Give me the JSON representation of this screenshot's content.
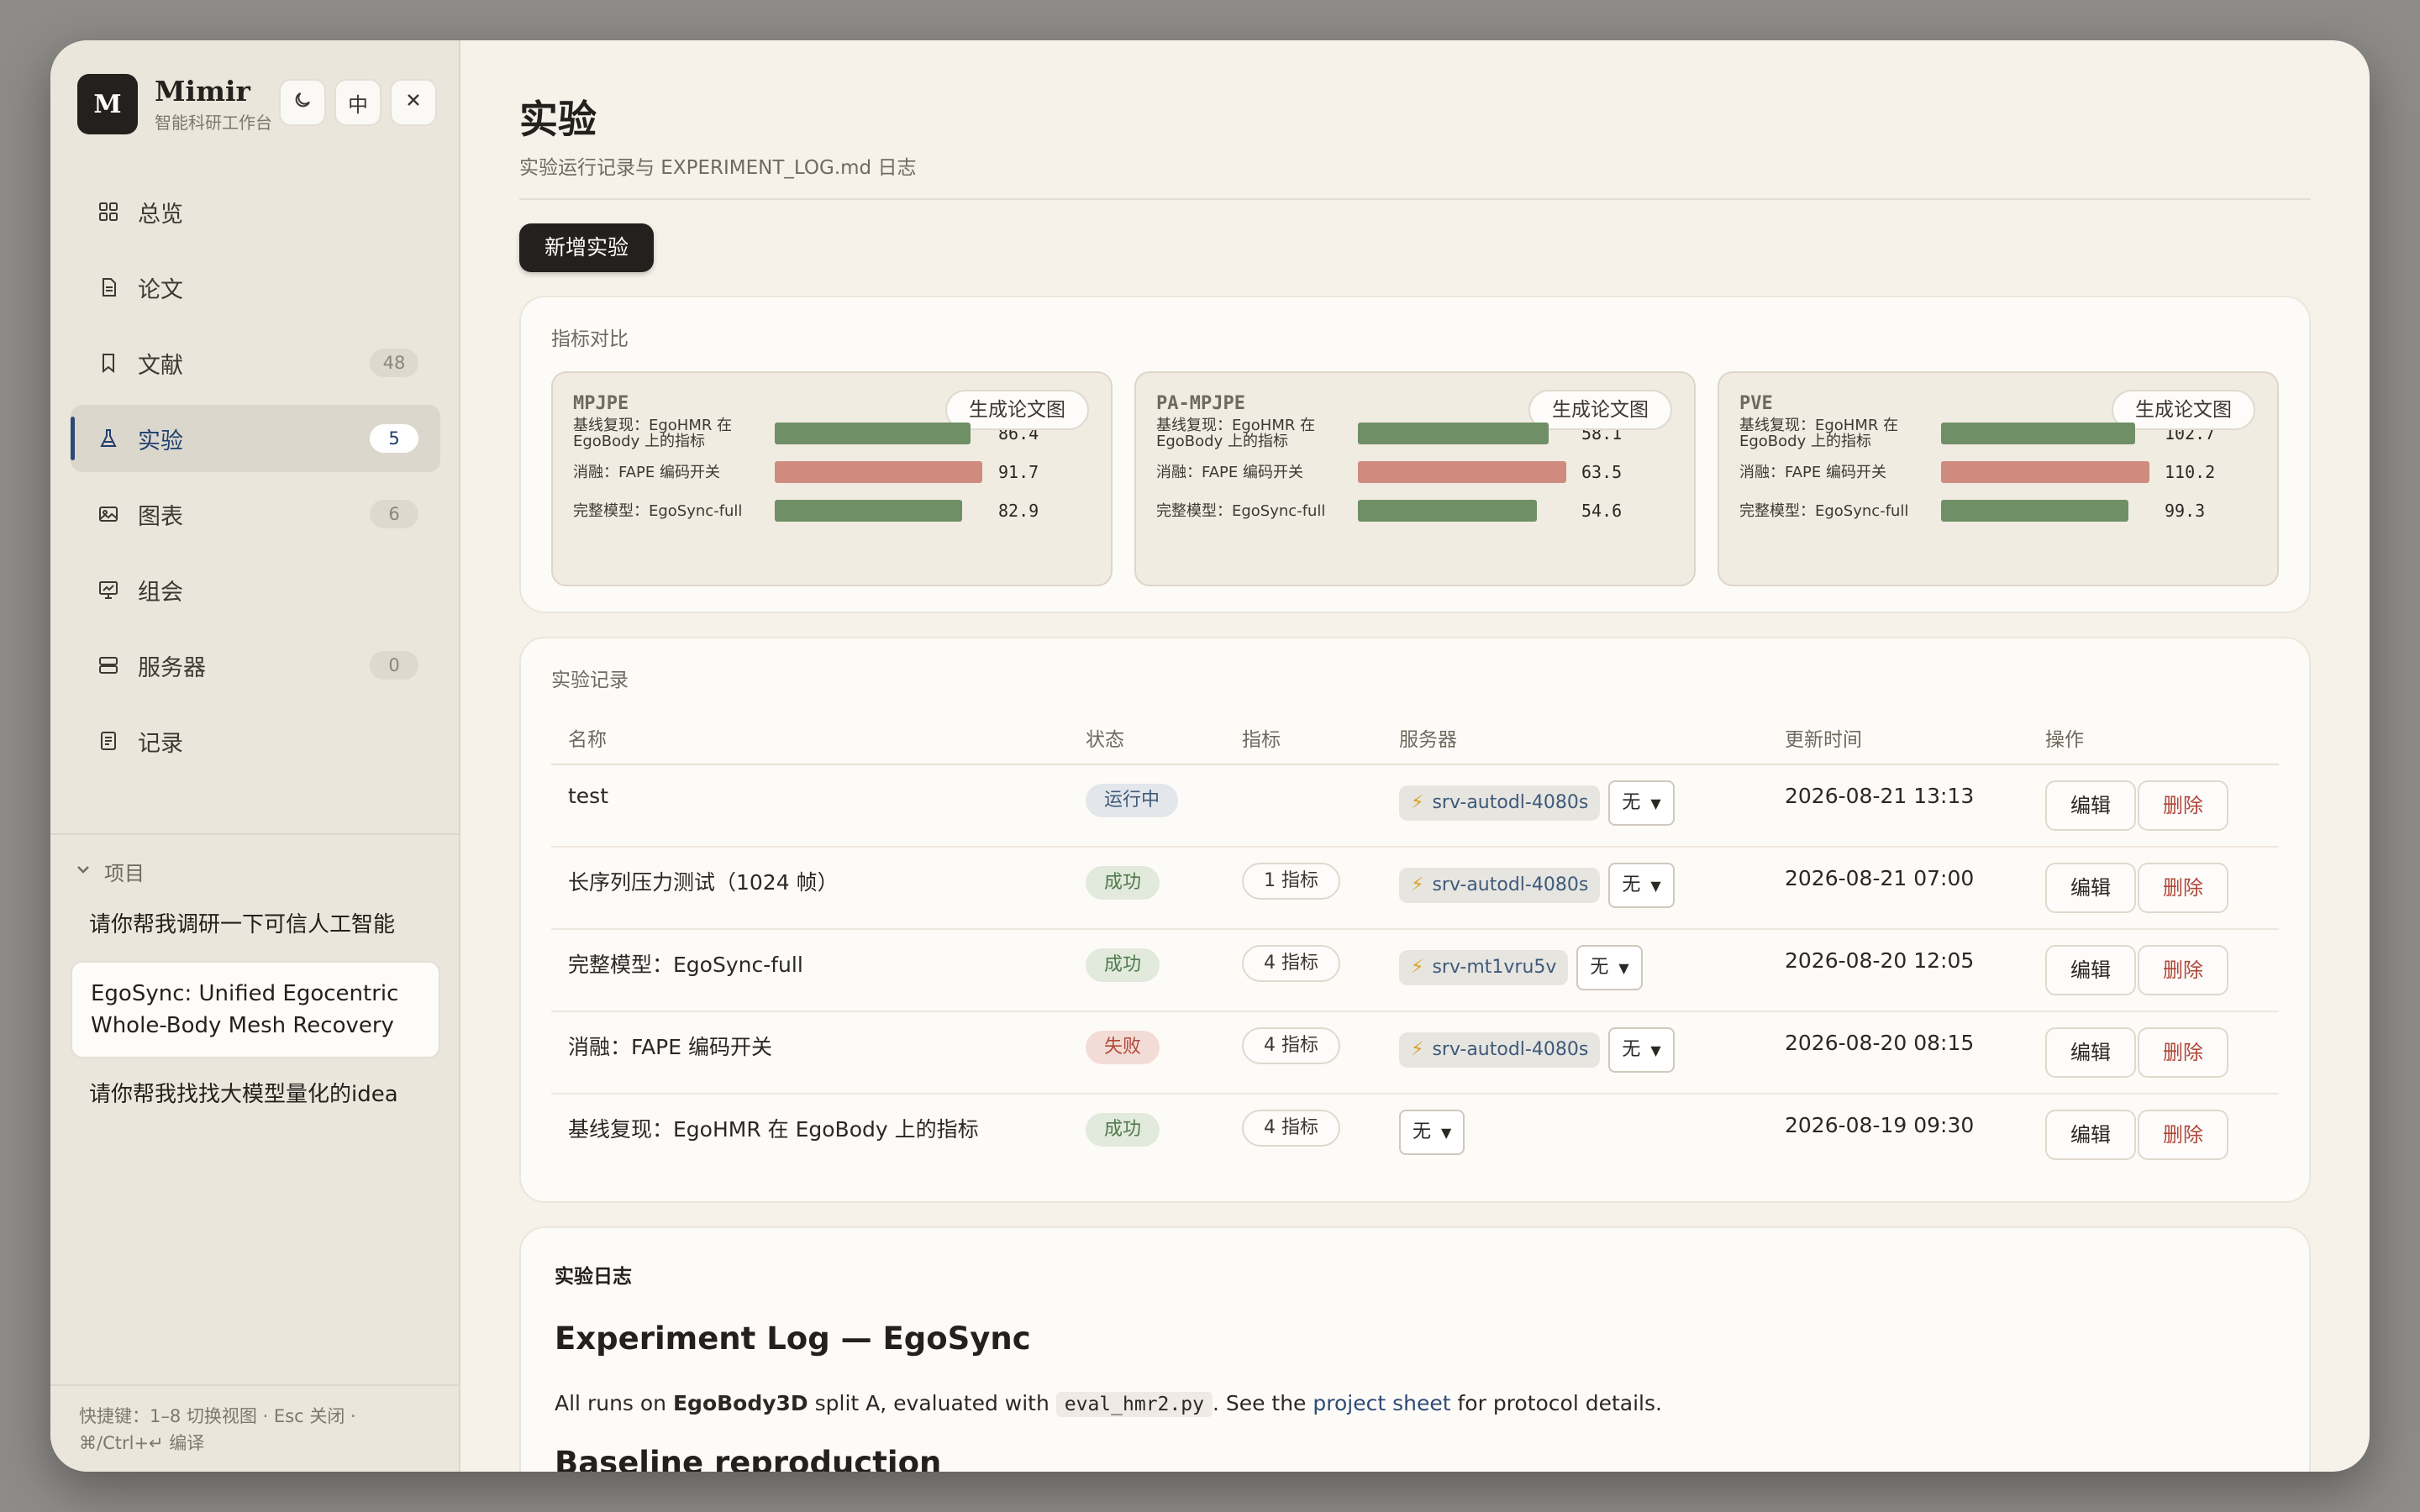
{
  "brand": {
    "name": "Mimir",
    "subtitle": "智能科研工作台",
    "logo_letter": "M"
  },
  "header_buttons": {
    "theme_icon": "moon-icon",
    "lang": "中",
    "close_icon": "close-icon"
  },
  "nav": [
    {
      "label": "总览",
      "icon": "grid-icon",
      "count": ""
    },
    {
      "label": "论文",
      "icon": "document-icon",
      "count": ""
    },
    {
      "label": "文献",
      "icon": "bookmark-icon",
      "count": "48"
    },
    {
      "label": "实验",
      "icon": "flask-icon",
      "count": "5"
    },
    {
      "label": "图表",
      "icon": "image-icon",
      "count": "6"
    },
    {
      "label": "组会",
      "icon": "presentation-icon",
      "count": ""
    },
    {
      "label": "服务器",
      "icon": "server-icon",
      "count": "0"
    },
    {
      "label": "记录",
      "icon": "notes-icon",
      "count": ""
    }
  ],
  "projects": {
    "header": "项目",
    "items": [
      "请你帮我调研一下可信人工智能",
      "EgoSync: Unified Egocentric Whole-Body Mesh Recovery",
      "请你帮我找找大模型量化的idea"
    ]
  },
  "footer": {
    "line1": "快捷键：1–8 切换视图 · Esc 关闭 ·",
    "line2": "⌘/Ctrl+↵ 编译"
  },
  "page": {
    "title": "实验",
    "subtitle": "实验运行记录与 EXPERIMENT_LOG.md 日志",
    "new_button": "新增实验"
  },
  "metrics_card": {
    "title": "指标对比",
    "gen_label": "生成论文图",
    "colors": {
      "good": "#6f8f66",
      "bad": "#cf8c7e"
    },
    "panels": [
      {
        "name": "MPJPE",
        "max": 92,
        "rows": [
          {
            "label": "基线复现：EgoHMR 在 EgoBody 上的指标",
            "value": "86.4",
            "kind": "good"
          },
          {
            "label": "消融：FAPE 编码开关",
            "value": "91.7",
            "kind": "bad"
          },
          {
            "label": "完整模型：EgoSync-full",
            "value": "82.9",
            "kind": "good"
          }
        ]
      },
      {
        "name": "PA-MPJPE",
        "max": 63.5,
        "rows": [
          {
            "label": "基线复现：EgoHMR 在 EgoBody 上的指标",
            "value": "58.1",
            "kind": "good"
          },
          {
            "label": "消融：FAPE 编码开关",
            "value": "63.5",
            "kind": "bad"
          },
          {
            "label": "完整模型：EgoSync-full",
            "value": "54.6",
            "kind": "good"
          }
        ]
      },
      {
        "name": "PVE",
        "max": 110.2,
        "rows": [
          {
            "label": "基线复现：EgoHMR 在 EgoBody 上的指标",
            "value": "102.7",
            "kind": "good"
          },
          {
            "label": "消融：FAPE 编码开关",
            "value": "110.2",
            "kind": "bad"
          },
          {
            "label": "完整模型：EgoSync-full",
            "value": "99.3",
            "kind": "good"
          }
        ]
      }
    ]
  },
  "records": {
    "title": "实验记录",
    "columns": [
      "名称",
      "状态",
      "指标",
      "服务器",
      "更新时间",
      "操作"
    ],
    "edit_label": "编辑",
    "delete_label": "删除",
    "select_value": "无",
    "rows": [
      {
        "name": "test",
        "status": "运行中",
        "status_kind": "run",
        "metrics": "",
        "server": "srv-autodl-4080s",
        "time": "2026-08-21 13:13"
      },
      {
        "name": "长序列压力测试（1024 帧）",
        "status": "成功",
        "status_kind": "ok",
        "metrics": "1 指标",
        "server": "srv-autodl-4080s",
        "time": "2026-08-21 07:00"
      },
      {
        "name": "完整模型：EgoSync-full",
        "status": "成功",
        "status_kind": "ok",
        "metrics": "4 指标",
        "server": "srv-mt1vru5v",
        "time": "2026-08-20 12:05"
      },
      {
        "name": "消融：FAPE 编码开关",
        "status": "失败",
        "status_kind": "fail",
        "metrics": "4 指标",
        "server": "srv-autodl-4080s",
        "time": "2026-08-20 08:15"
      },
      {
        "name": "基线复现：EgoHMR 在 EgoBody 上的指标",
        "status": "成功",
        "status_kind": "ok",
        "metrics": "4 指标",
        "server": "",
        "time": "2026-08-19 09:30"
      }
    ]
  },
  "log": {
    "label": "实验日志",
    "h1": "Experiment Log — EgoSync",
    "p_pre": "All runs on ",
    "p_bold": "EgoBody3D",
    "p_mid": " split A, evaluated with ",
    "p_code": "eval_hmr2.py",
    "p_mid2": ". See the ",
    "p_link": "project sheet",
    "p_post": " for protocol details.",
    "h2": "Baseline reproduction"
  }
}
